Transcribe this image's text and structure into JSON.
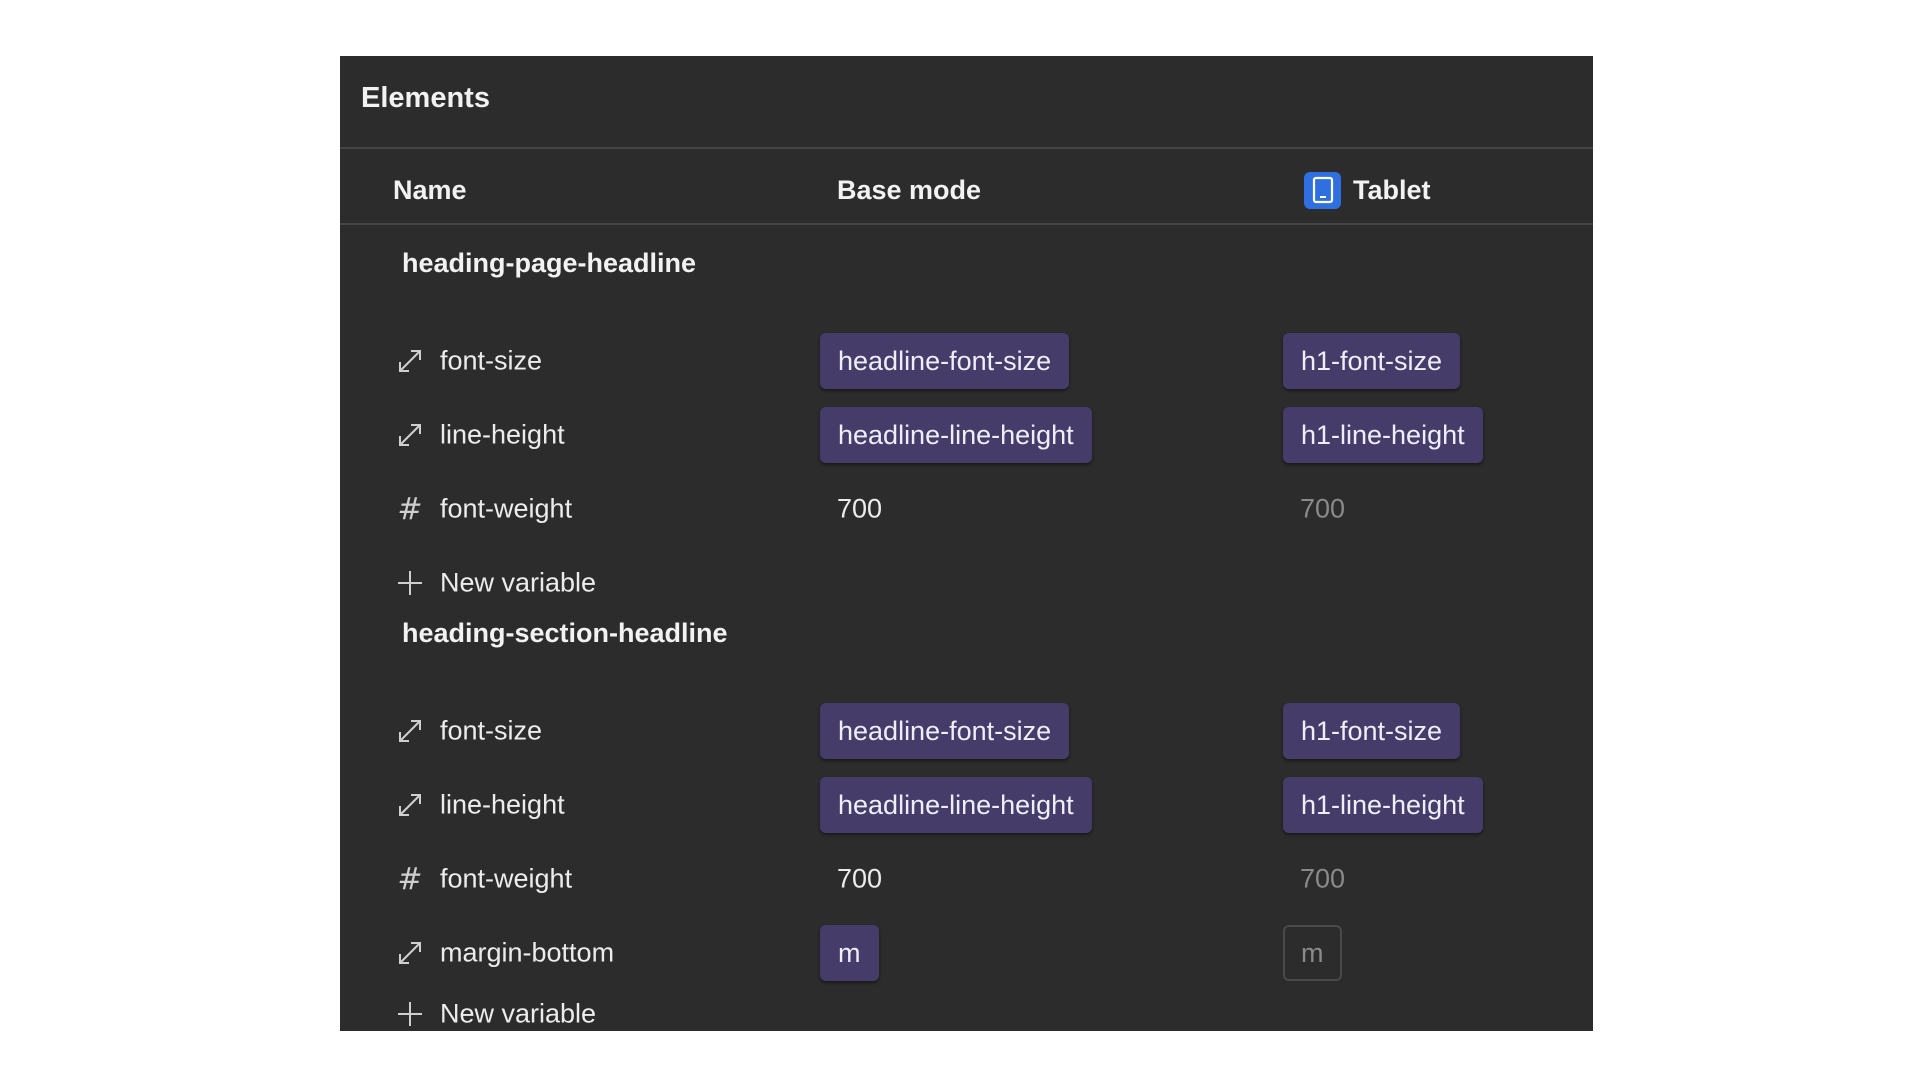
{
  "panel": {
    "title": "Elements"
  },
  "columns": {
    "name": "Name",
    "base": "Base mode",
    "tablet": "Tablet"
  },
  "groups": [
    {
      "title": "heading-page-headline",
      "rows": [
        {
          "icon": "resize-diagonal-icon",
          "name": "font-size",
          "base": "headline-font-size",
          "tablet": "h1-font-size"
        },
        {
          "icon": "resize-diagonal-icon",
          "name": "line-height",
          "base": "headline-line-height",
          "tablet": "h1-line-height"
        },
        {
          "icon": "hash-icon",
          "name": "font-weight",
          "base": "700",
          "tablet": "700"
        }
      ],
      "add_label": "New variable"
    },
    {
      "title": "heading-section-headline",
      "rows": [
        {
          "icon": "resize-diagonal-icon",
          "name": "font-size",
          "base": "headline-font-size",
          "tablet": "h1-font-size"
        },
        {
          "icon": "resize-diagonal-icon",
          "name": "line-height",
          "base": "headline-line-height",
          "tablet": "h1-line-height"
        },
        {
          "icon": "hash-icon",
          "name": "font-weight",
          "base": "700",
          "tablet": "700"
        },
        {
          "icon": "resize-diagonal-icon",
          "name": "margin-bottom",
          "base": "m",
          "tablet": "m"
        }
      ],
      "add_label": "New variable"
    }
  ],
  "colors": {
    "panel_bg": "#2c2c2c",
    "chip_bg": "#463c6a",
    "tablet_icon_bg": "#2f6fe0",
    "muted_text": "#8a8a8a"
  }
}
